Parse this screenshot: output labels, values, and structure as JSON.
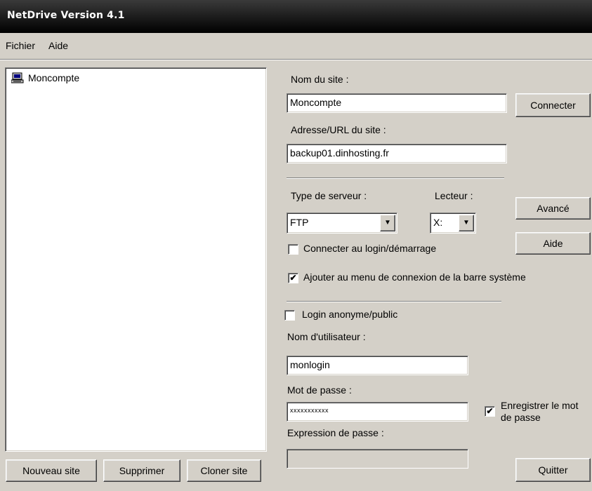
{
  "window": {
    "title": "NetDrive Version 4.1"
  },
  "menu": {
    "items": [
      {
        "label": "Fichier"
      },
      {
        "label": "Aide"
      }
    ]
  },
  "sites": {
    "items": [
      {
        "label": "Moncompte",
        "icon": "computer-icon"
      }
    ]
  },
  "left_buttons": {
    "new_site": "Nouveau site",
    "delete": "Supprimer",
    "clone": "Cloner site"
  },
  "form": {
    "site_name_label": "Nom du site :",
    "site_name_value": "Moncompte",
    "url_label": "Adresse/URL du site :",
    "url_value": "backup01.dinhosting.fr",
    "server_type_label": "Type de serveur :",
    "server_type_value": "FTP",
    "drive_label": "Lecteur :",
    "drive_value": "X:",
    "connect_at_login_label": "Connecter au login/démarrage",
    "connect_at_login_checked": false,
    "add_to_tray_label": "Ajouter au menu de connexion de la barre système",
    "add_to_tray_checked": true,
    "anonymous_label": "Login anonyme/public",
    "anonymous_checked": false,
    "username_label": "Nom d'utilisateur :",
    "username_value": "monlogin",
    "password_label": "Mot de passe :",
    "password_value": "xxxxxxxxxxx",
    "save_password_label_line1": "Enregistrer le mot",
    "save_password_label_line2": "de passe",
    "save_password_checked": true,
    "passphrase_label": "Expression de passe :",
    "passphrase_value": ""
  },
  "right_buttons": {
    "connect": "Connecter",
    "advanced": "Avancé",
    "help": "Aide",
    "quit": "Quitter"
  }
}
